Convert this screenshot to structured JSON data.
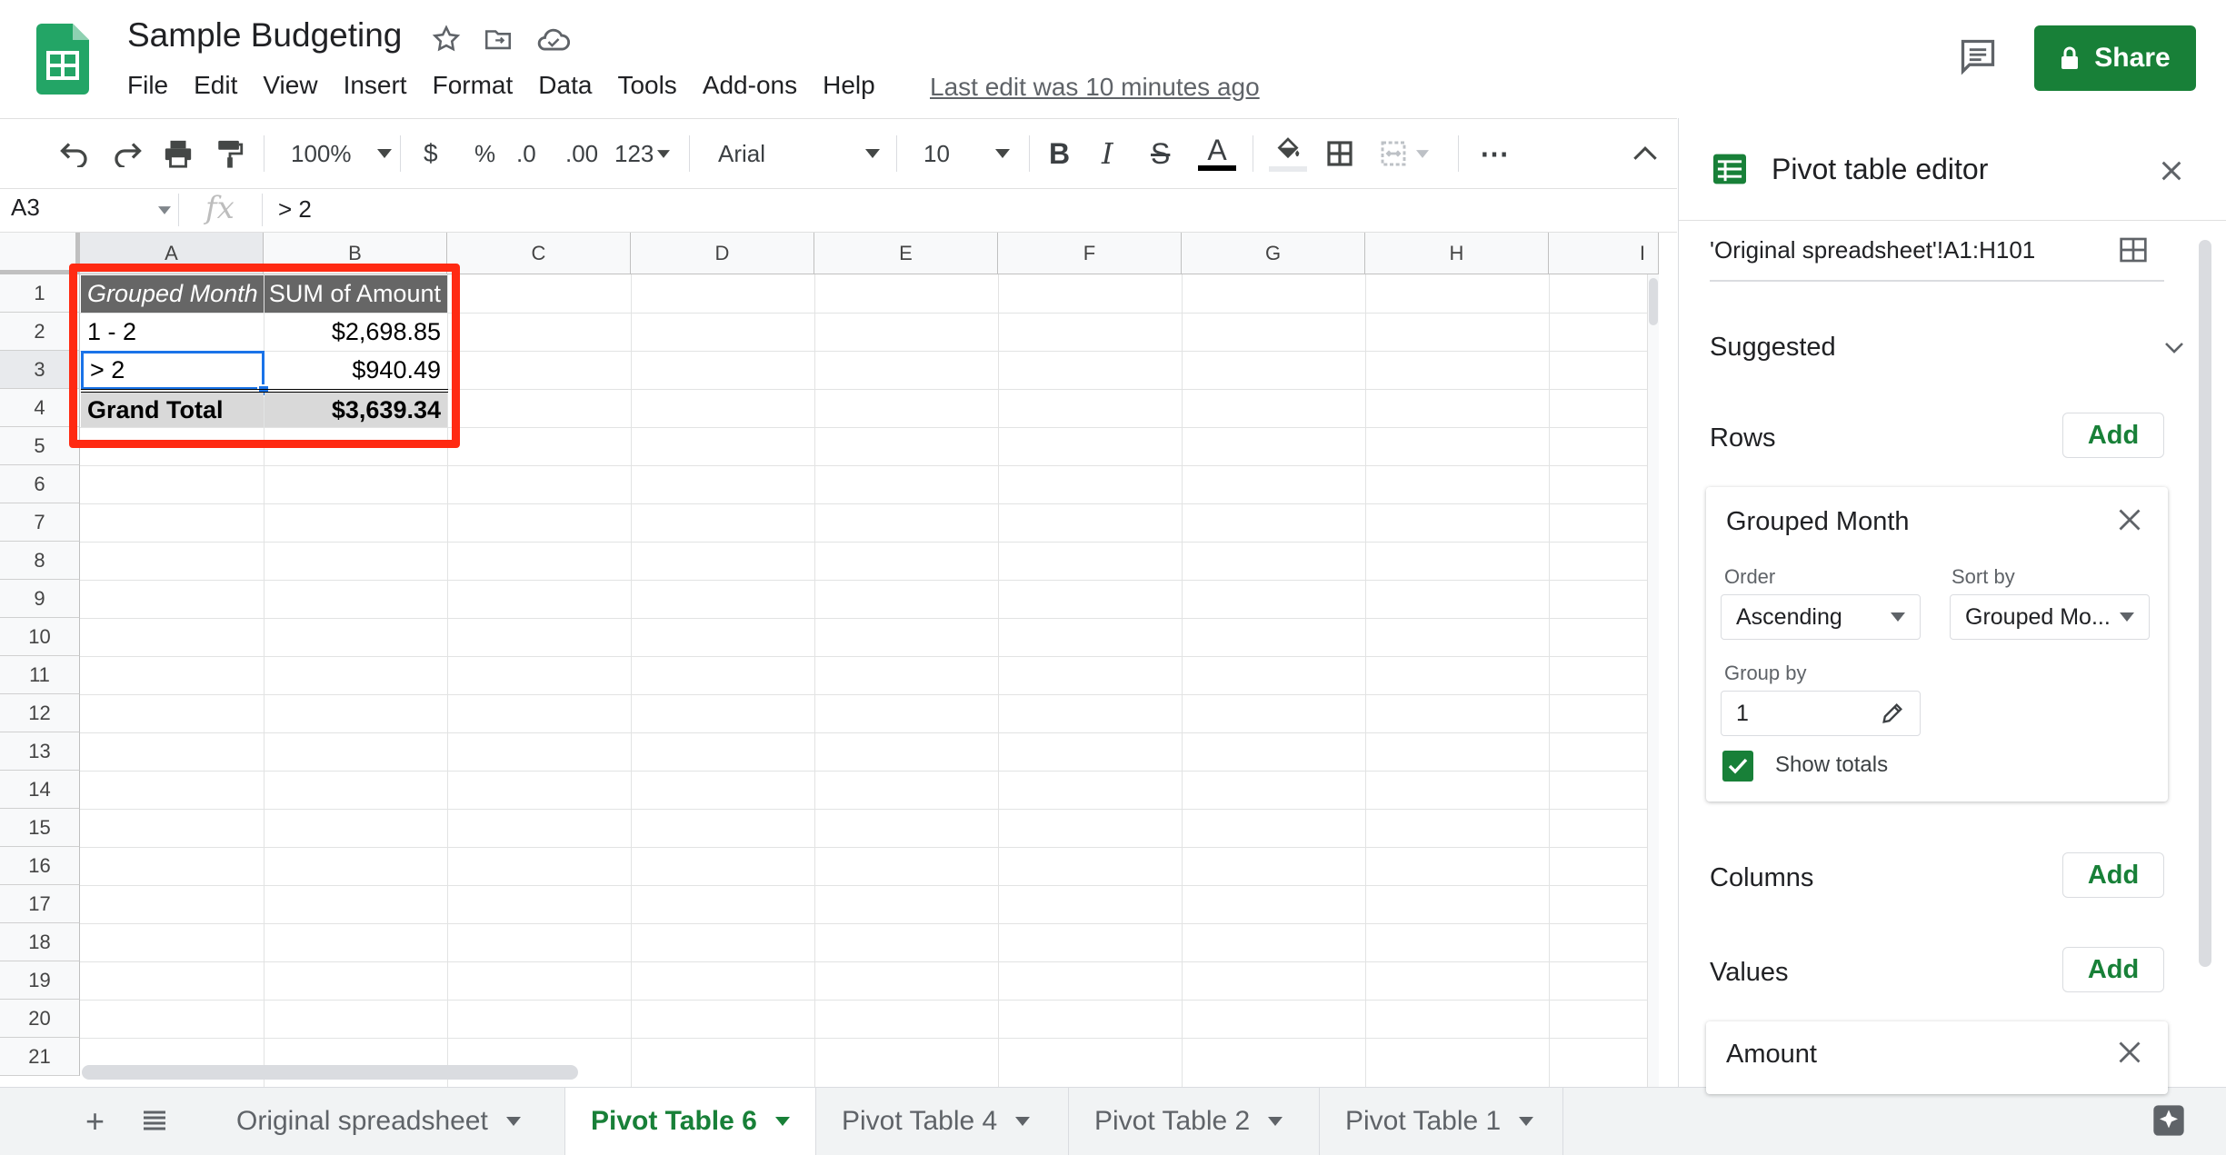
{
  "doc": {
    "title": "Sample Budgeting",
    "last_edit": "Last edit was 10 minutes ago",
    "share_label": "Share"
  },
  "menu": [
    "File",
    "Edit",
    "View",
    "Insert",
    "Format",
    "Data",
    "Tools",
    "Add-ons",
    "Help"
  ],
  "toolbar": {
    "zoom": "100%",
    "currency": "$",
    "percent": "%",
    "decrease_decimal": ".0",
    "increase_decimal": ".00",
    "more_formats": "123",
    "font": "Arial",
    "font_size": "10",
    "bold": "B",
    "italic": "I",
    "strike": "S",
    "text_color": "A",
    "more": "⋯"
  },
  "formula_bar": {
    "cell_ref": "A3",
    "fx": "fx",
    "value": "> 2"
  },
  "grid": {
    "columns": [
      "A",
      "B",
      "C",
      "D",
      "E",
      "F",
      "G",
      "H",
      "I"
    ],
    "rows": [
      "1",
      "2",
      "3",
      "4",
      "5",
      "6",
      "7",
      "8",
      "9",
      "10",
      "11",
      "12",
      "13",
      "14",
      "15",
      "16",
      "17",
      "18",
      "19",
      "20",
      "21"
    ],
    "pivot": {
      "header_row": "Grouped Month",
      "header_value": "SUM of Amount",
      "rows": [
        {
          "label": "1 - 2",
          "value": "$2,698.85"
        },
        {
          "label": "> 2",
          "value": "$940.49"
        }
      ],
      "total_label": "Grand Total",
      "total_value": "$3,639.34"
    }
  },
  "sheets": {
    "tabs": [
      {
        "label": "Original spreadsheet",
        "active": false
      },
      {
        "label": "Pivot Table 6",
        "active": true
      },
      {
        "label": "Pivot Table 4",
        "active": false
      },
      {
        "label": "Pivot Table 2",
        "active": false
      },
      {
        "label": "Pivot Table 1",
        "active": false
      }
    ]
  },
  "panel": {
    "title": "Pivot table editor",
    "range": "'Original spreadsheet'!A1:H101",
    "suggested": "Suggested",
    "rows_label": "Rows",
    "columns_label": "Columns",
    "values_label": "Values",
    "add_label": "Add",
    "row_field": {
      "name": "Grouped Month",
      "order_label": "Order",
      "order_value": "Ascending",
      "sort_label": "Sort by",
      "sort_value": "Grouped Mo...",
      "group_label": "Group by",
      "group_value": "1",
      "show_totals": "Show totals",
      "show_totals_checked": true
    },
    "value_field": {
      "name": "Amount"
    }
  },
  "colors": {
    "brand_green": "#188038",
    "highlight_red": "#ff2a12",
    "header_gray": "#666666",
    "total_gray": "#d9d9d9",
    "selection_blue": "#1a73e8"
  }
}
